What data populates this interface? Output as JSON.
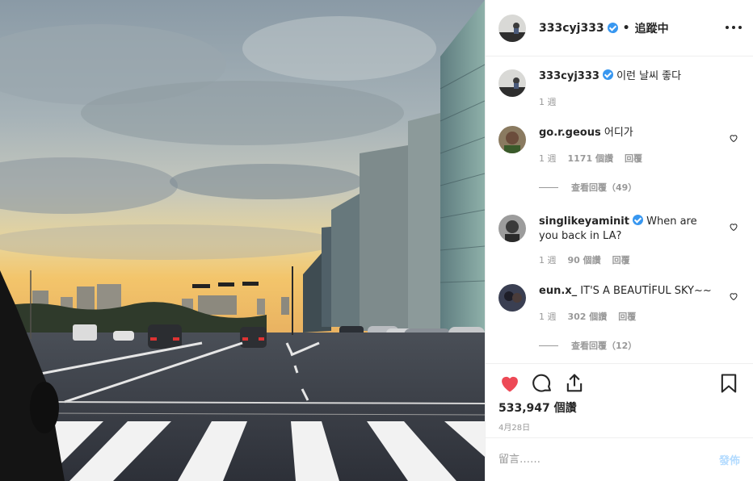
{
  "post": {
    "author": "333cyj333",
    "follow_status": "追蹤中",
    "dot": "•",
    "more_icon": "more-horizontal-icon"
  },
  "caption": {
    "user": "333cyj333",
    "text": "이런 날씨 좋다",
    "time": "1 週"
  },
  "comments": [
    {
      "user": "go.r.geous",
      "text": "어디가",
      "time": "1 週",
      "likes": "1171 個讚",
      "reply": "回覆",
      "view_replies": "查看回覆（49）",
      "avatar_color": "#6b4c3b"
    },
    {
      "user": "singlikeyaminit",
      "verified": true,
      "text": "When are you back in LA?",
      "time": "1 週",
      "likes": "90 個讚",
      "reply": "回覆",
      "avatar_color": "#5a5a5a"
    },
    {
      "user": "eun.x_",
      "text": "IT'S A BEAUTİFUL SKY~~",
      "time": "1 週",
      "likes": "302 個讚",
      "reply": "回覆",
      "view_replies": "查看回覆（12）",
      "avatar_color": "#2c2f3a"
    }
  ],
  "stats": {
    "likes": "533,947 個讚",
    "date": "4月28日"
  },
  "comment_input": {
    "placeholder": "留言……",
    "post_label": "發佈"
  },
  "colors": {
    "like_red": "#ed4956",
    "verified_blue": "#3897f0",
    "post_disabled": "#b3dbff",
    "muted": "#999999"
  }
}
